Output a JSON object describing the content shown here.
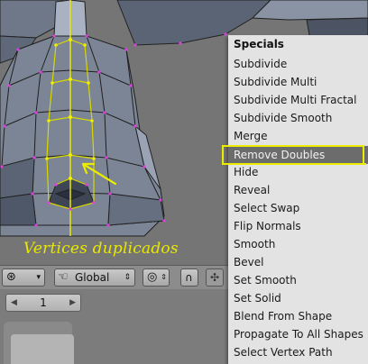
{
  "annotation": "Vertices duplicados",
  "header": {
    "transform_orientation": "Global",
    "pivot_icon": "pivot-icon",
    "hand_icon": "hand-icon",
    "dot_icon": "dot-circle-icon",
    "magnet_icon": "magnet-icon",
    "snap_icon": "snap-icon"
  },
  "lower": {
    "frame_value": "1"
  },
  "menu": {
    "title": "Specials",
    "selected_item": "Remove Doubles",
    "items": [
      "Subdivide",
      "Subdivide Multi",
      "Subdivide Multi Fractal",
      "Subdivide Smooth",
      "Merge",
      "Remove Doubles",
      "Hide",
      "Reveal",
      "Select Swap",
      "Flip Normals",
      "Smooth",
      "Bevel",
      "Set Smooth",
      "Set Solid",
      "Blend From Shape",
      "Propagate To All Shapes",
      "Select Vertex Path"
    ]
  },
  "colors": {
    "highlight": "#ecec00",
    "menu_bg": "#e3e3e3",
    "menu_selected": "#6c6c6c",
    "mesh_face": "#7f8898",
    "vertex": "#e040e0"
  }
}
